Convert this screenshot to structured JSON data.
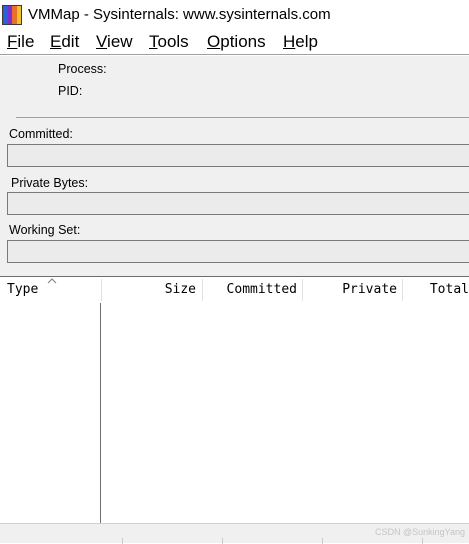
{
  "window": {
    "title": "VMMap - Sysinternals: www.sysinternals.com",
    "icon": "vmmap-app-icon",
    "icon_colors": [
      "#2d5fd8",
      "#7a2fd0",
      "#e8702a",
      "#f2c12e"
    ]
  },
  "menu": [
    {
      "accel": "F",
      "rest": "ile"
    },
    {
      "accel": "E",
      "rest": "dit"
    },
    {
      "accel": "V",
      "rest": "iew"
    },
    {
      "accel": "T",
      "rest": "ools"
    },
    {
      "accel": "O",
      "rest": "ptions"
    },
    {
      "accel": "H",
      "rest": "elp"
    }
  ],
  "info": {
    "process_label": "Process:",
    "pid_label": "PID:",
    "committed_label": "Committed:",
    "private_bytes_label": "Private Bytes:",
    "working_set_label": "Working Set:"
  },
  "table": {
    "columns": [
      "Type",
      "Size",
      "Committed",
      "Private",
      "Total"
    ],
    "sort_column": "Type",
    "sort_icon": "sort-ascending-icon",
    "rows": []
  },
  "watermark": "CSDN @SunkingYang"
}
